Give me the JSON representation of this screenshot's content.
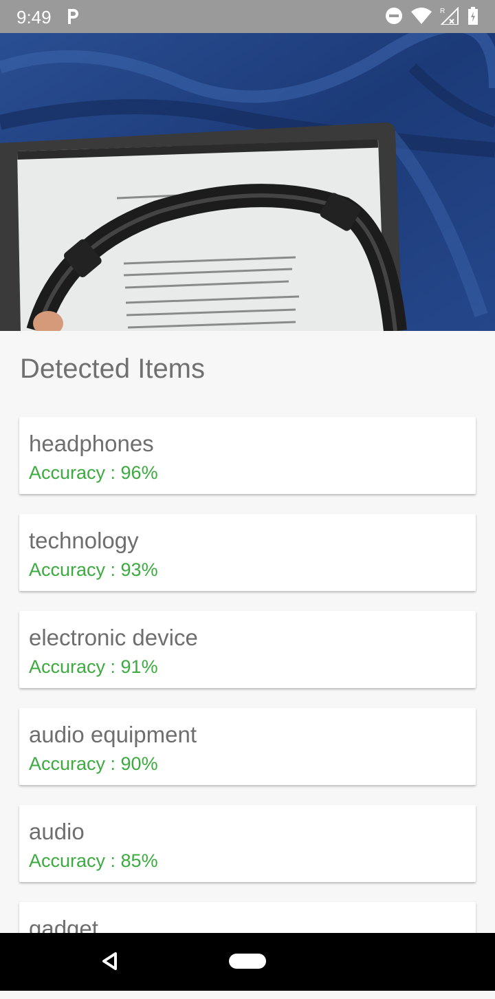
{
  "status_bar": {
    "time": "9:49",
    "icons": [
      "p-icon",
      "dnd-icon",
      "wifi-icon",
      "signal-icon",
      "battery-icon"
    ]
  },
  "hero": {
    "description_icon": "photo-headphones-on-laptop"
  },
  "section_title": "Detected Items",
  "items": [
    {
      "name": "headphones",
      "accuracy": "Accuracy : 96%"
    },
    {
      "name": "technology",
      "accuracy": "Accuracy : 93%"
    },
    {
      "name": "electronic device",
      "accuracy": "Accuracy : 91%"
    },
    {
      "name": "audio equipment",
      "accuracy": "Accuracy : 90%"
    },
    {
      "name": "audio",
      "accuracy": "Accuracy : 85%"
    },
    {
      "name": "gadget",
      "accuracy": ""
    }
  ],
  "colors": {
    "accuracy": "#3cab3f",
    "title": "#707070",
    "status_bar": "#9a9a9a"
  }
}
